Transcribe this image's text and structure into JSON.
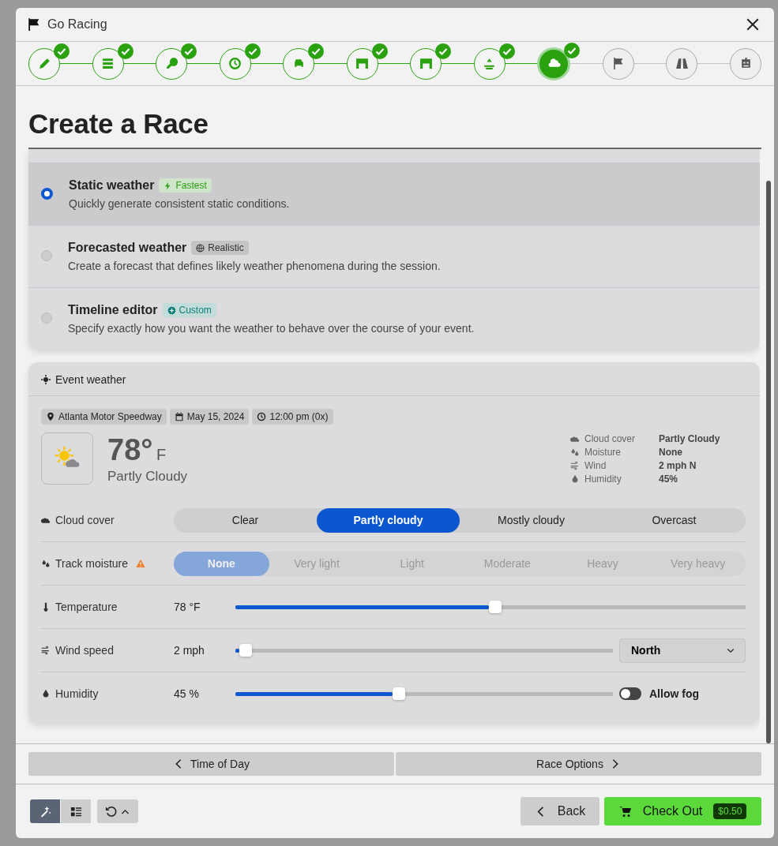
{
  "window": {
    "title": "Go Racing"
  },
  "steps": [
    {
      "completed": true,
      "selected": false
    },
    {
      "completed": true,
      "selected": false
    },
    {
      "completed": true,
      "selected": false
    },
    {
      "completed": true,
      "selected": false
    },
    {
      "completed": true,
      "selected": false
    },
    {
      "completed": true,
      "selected": false
    },
    {
      "completed": true,
      "selected": false
    },
    {
      "completed": true,
      "selected": false
    },
    {
      "completed": true,
      "selected": true
    },
    {
      "completed": false,
      "selected": false
    },
    {
      "completed": false,
      "selected": false
    },
    {
      "completed": false,
      "selected": false
    }
  ],
  "heading": "Create a Race",
  "weather_modes": [
    {
      "title": "Static weather",
      "badge": "Fastest",
      "kind": "fast",
      "description": "Quickly generate consistent static conditions.",
      "selected": true
    },
    {
      "title": "Forecasted weather",
      "badge": "Realistic",
      "kind": "globe",
      "description": "Create a forecast that defines likely weather phenomena during the session.",
      "selected": false
    },
    {
      "title": "Timeline editor",
      "badge": "Custom",
      "kind": "plus",
      "description": "Specify exactly how you want the weather to behave over the course of your event.",
      "selected": false
    }
  ],
  "event_weather": {
    "title": "Event weather",
    "chips": [
      {
        "kind": "pin",
        "text": "Atlanta Motor Speedway"
      },
      {
        "kind": "calendar",
        "text": "May 15, 2024"
      },
      {
        "kind": "clock",
        "text": "12:00 pm (0x)"
      }
    ],
    "temperature": "78°",
    "unit": "F",
    "condition": "Partly Cloudy",
    "summary": [
      {
        "kind": "cloud",
        "label": "Cloud cover",
        "value": "Partly Cloudy"
      },
      {
        "kind": "drops",
        "label": "Moisture",
        "value": "None"
      },
      {
        "kind": "wind",
        "label": "Wind",
        "value": "2 mph N"
      },
      {
        "kind": "drop",
        "label": "Humidity",
        "value": "45%"
      }
    ]
  },
  "cloud_cover": {
    "label": "Cloud cover",
    "options": [
      {
        "label": "Clear",
        "selected": false
      },
      {
        "label": "Partly cloudy",
        "selected": true
      },
      {
        "label": "Mostly cloudy",
        "selected": false
      },
      {
        "label": "Overcast",
        "selected": false
      }
    ]
  },
  "track_moisture": {
    "label": "Track moisture",
    "warning": true,
    "disabled": true,
    "options": [
      {
        "label": "None",
        "selected": true
      },
      {
        "label": "Very light",
        "selected": false
      },
      {
        "label": "Light",
        "selected": false
      },
      {
        "label": "Moderate",
        "selected": false
      },
      {
        "label": "Heavy",
        "selected": false
      },
      {
        "label": "Very heavy",
        "selected": false
      }
    ]
  },
  "sliders": [
    {
      "kind": "thermometer",
      "label": "Temperature",
      "reading": "78 °F",
      "level": 0.51
    },
    {
      "kind": "wind",
      "label": "Wind speed",
      "reading": "2 mph",
      "level": 0.01,
      "direction": "North"
    },
    {
      "kind": "drop",
      "label": "Humidity",
      "reading": "45 %",
      "level": 0.43,
      "toggle": {
        "label": "Allow fog",
        "on": false
      }
    }
  ],
  "nav": {
    "previous": "Time of Day",
    "next": "Race Options"
  },
  "footer": {
    "view_modes": [
      {
        "kind": "wand",
        "selected": true
      },
      {
        "kind": "list",
        "selected": false
      }
    ],
    "back": "Back",
    "checkout": "Check Out",
    "price": "$0.50"
  }
}
